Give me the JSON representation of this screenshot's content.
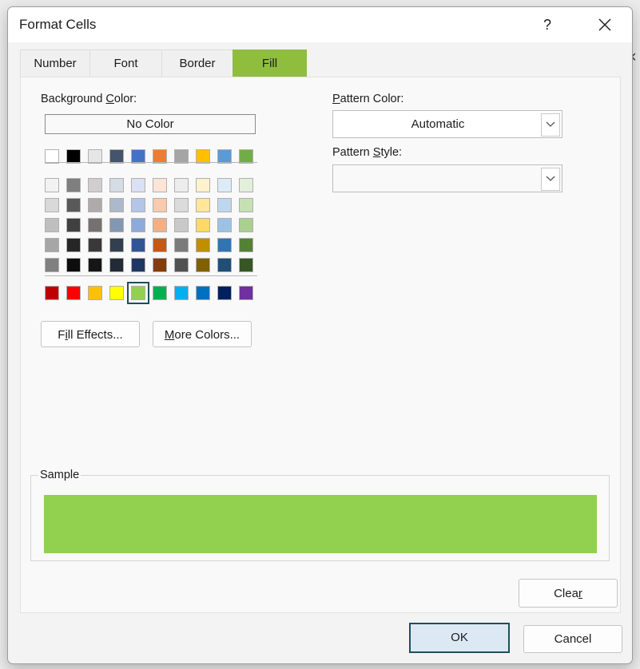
{
  "window": {
    "title": "Format Cells",
    "help_label": "?"
  },
  "tabs": [
    {
      "label": "Number"
    },
    {
      "label": "Font"
    },
    {
      "label": "Border"
    },
    {
      "label": "Fill",
      "active": true
    }
  ],
  "background_color": {
    "label_pre": "Background ",
    "label_access": "C",
    "label_post": "olor:",
    "no_color_label": "No Color",
    "selected_color": "#92D050",
    "theme_top_row": [
      "#FFFFFF",
      "#000000",
      "#E7E6E6",
      "#44546A",
      "#4472C4",
      "#ED7D31",
      "#A5A5A5",
      "#FFC000",
      "#5B9BD5",
      "#70AD47"
    ],
    "theme_shades": [
      [
        "#F2F2F2",
        "#7F7F7F",
        "#D0CECE",
        "#D6DCE4",
        "#D9E1F2",
        "#FCE4D6",
        "#EDEDED",
        "#FFF2CC",
        "#DDEBF7",
        "#E2EFDA"
      ],
      [
        "#D9D9D9",
        "#595959",
        "#AEAAAA",
        "#ACB9CA",
        "#B4C6E7",
        "#F8CBAD",
        "#DBDBDB",
        "#FFE699",
        "#BDD7EE",
        "#C6E0B4"
      ],
      [
        "#BFBFBF",
        "#404040",
        "#757171",
        "#8497B0",
        "#8EA9DB",
        "#F4B084",
        "#C9C9C9",
        "#FFD966",
        "#9BC2E6",
        "#A9D08E"
      ],
      [
        "#A6A6A6",
        "#262626",
        "#3A3838",
        "#333F4F",
        "#305496",
        "#C65911",
        "#7B7B7B",
        "#BF8F00",
        "#2F75B5",
        "#548235"
      ],
      [
        "#808080",
        "#0D0D0D",
        "#161616",
        "#222B35",
        "#203764",
        "#833C0C",
        "#525252",
        "#806000",
        "#1F4E78",
        "#375623"
      ]
    ],
    "standard_colors": [
      "#C00000",
      "#FF0000",
      "#FFC000",
      "#FFFF00",
      "#92D050",
      "#00B050",
      "#00B0F0",
      "#0070C0",
      "#002060",
      "#7030A0"
    ],
    "selected_standard_index": 4
  },
  "buttons": {
    "fill_effects_pre": "F",
    "fill_effects_access": "i",
    "fill_effects_post": "ll Effects...",
    "more_colors_access": "M",
    "more_colors_post": "ore Colors...",
    "clear_pre": "Clea",
    "clear_access": "r",
    "ok": "OK",
    "cancel": "Cancel"
  },
  "pattern": {
    "color_label_access": "P",
    "color_label_post": "attern Color:",
    "color_value": "Automatic",
    "style_label_pre": "Pattern ",
    "style_label_access": "S",
    "style_label_post": "tyle:",
    "style_value": ""
  },
  "sample": {
    "label": "Sample",
    "color": "#92D050"
  },
  "colors": {
    "active_tab": "#8FBE3F",
    "ok_border": "#1F4E5A",
    "ok_fill": "#DCE9F5"
  },
  "icons": {
    "close": "close-icon",
    "dropdown": "chevron-down-icon"
  }
}
